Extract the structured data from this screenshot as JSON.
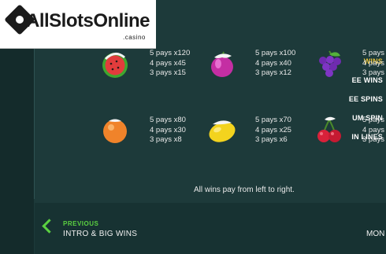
{
  "logo": {
    "text": "AllSlotsOnline",
    "sub": ".casino"
  },
  "menu": [
    {
      "label": "WINS",
      "active": true
    },
    {
      "label": "EE WINS",
      "active": false
    },
    {
      "label": "EE SPINS",
      "active": false
    },
    {
      "label": "UM SPIN",
      "active": false
    },
    {
      "label": "IN LINES",
      "active": false
    }
  ],
  "paytable": [
    {
      "symbol": "watermelon-icon",
      "pays": [
        "5 pays x120",
        "4 pays x45",
        "3 pays x15"
      ]
    },
    {
      "symbol": "plum-icon",
      "pays": [
        "5 pays x100",
        "4 pays x40",
        "3 pays x12"
      ]
    },
    {
      "symbol": "grapes-icon",
      "pays": [
        "5 pays",
        "4 pays",
        "3 pays"
      ]
    },
    {
      "symbol": "orange-icon",
      "pays": [
        "5 pays x80",
        "4 pays x30",
        "3 pays x8"
      ]
    },
    {
      "symbol": "lemon-icon",
      "pays": [
        "5 pays x70",
        "4 pays x25",
        "3 pays x6"
      ]
    },
    {
      "symbol": "cherries-icon",
      "pays": [
        "5 pays",
        "4 pays",
        "3 pays"
      ]
    }
  ],
  "note": "All wins pay from left to right.",
  "footer": {
    "prev_label": "PREVIOUS",
    "prev_dest": "INTRO & BIG WINS",
    "next_dest": "MON"
  },
  "colors": {
    "background": "#1d3a3a",
    "active_menu": "#e8c33a",
    "nav_accent": "#5bd141"
  }
}
